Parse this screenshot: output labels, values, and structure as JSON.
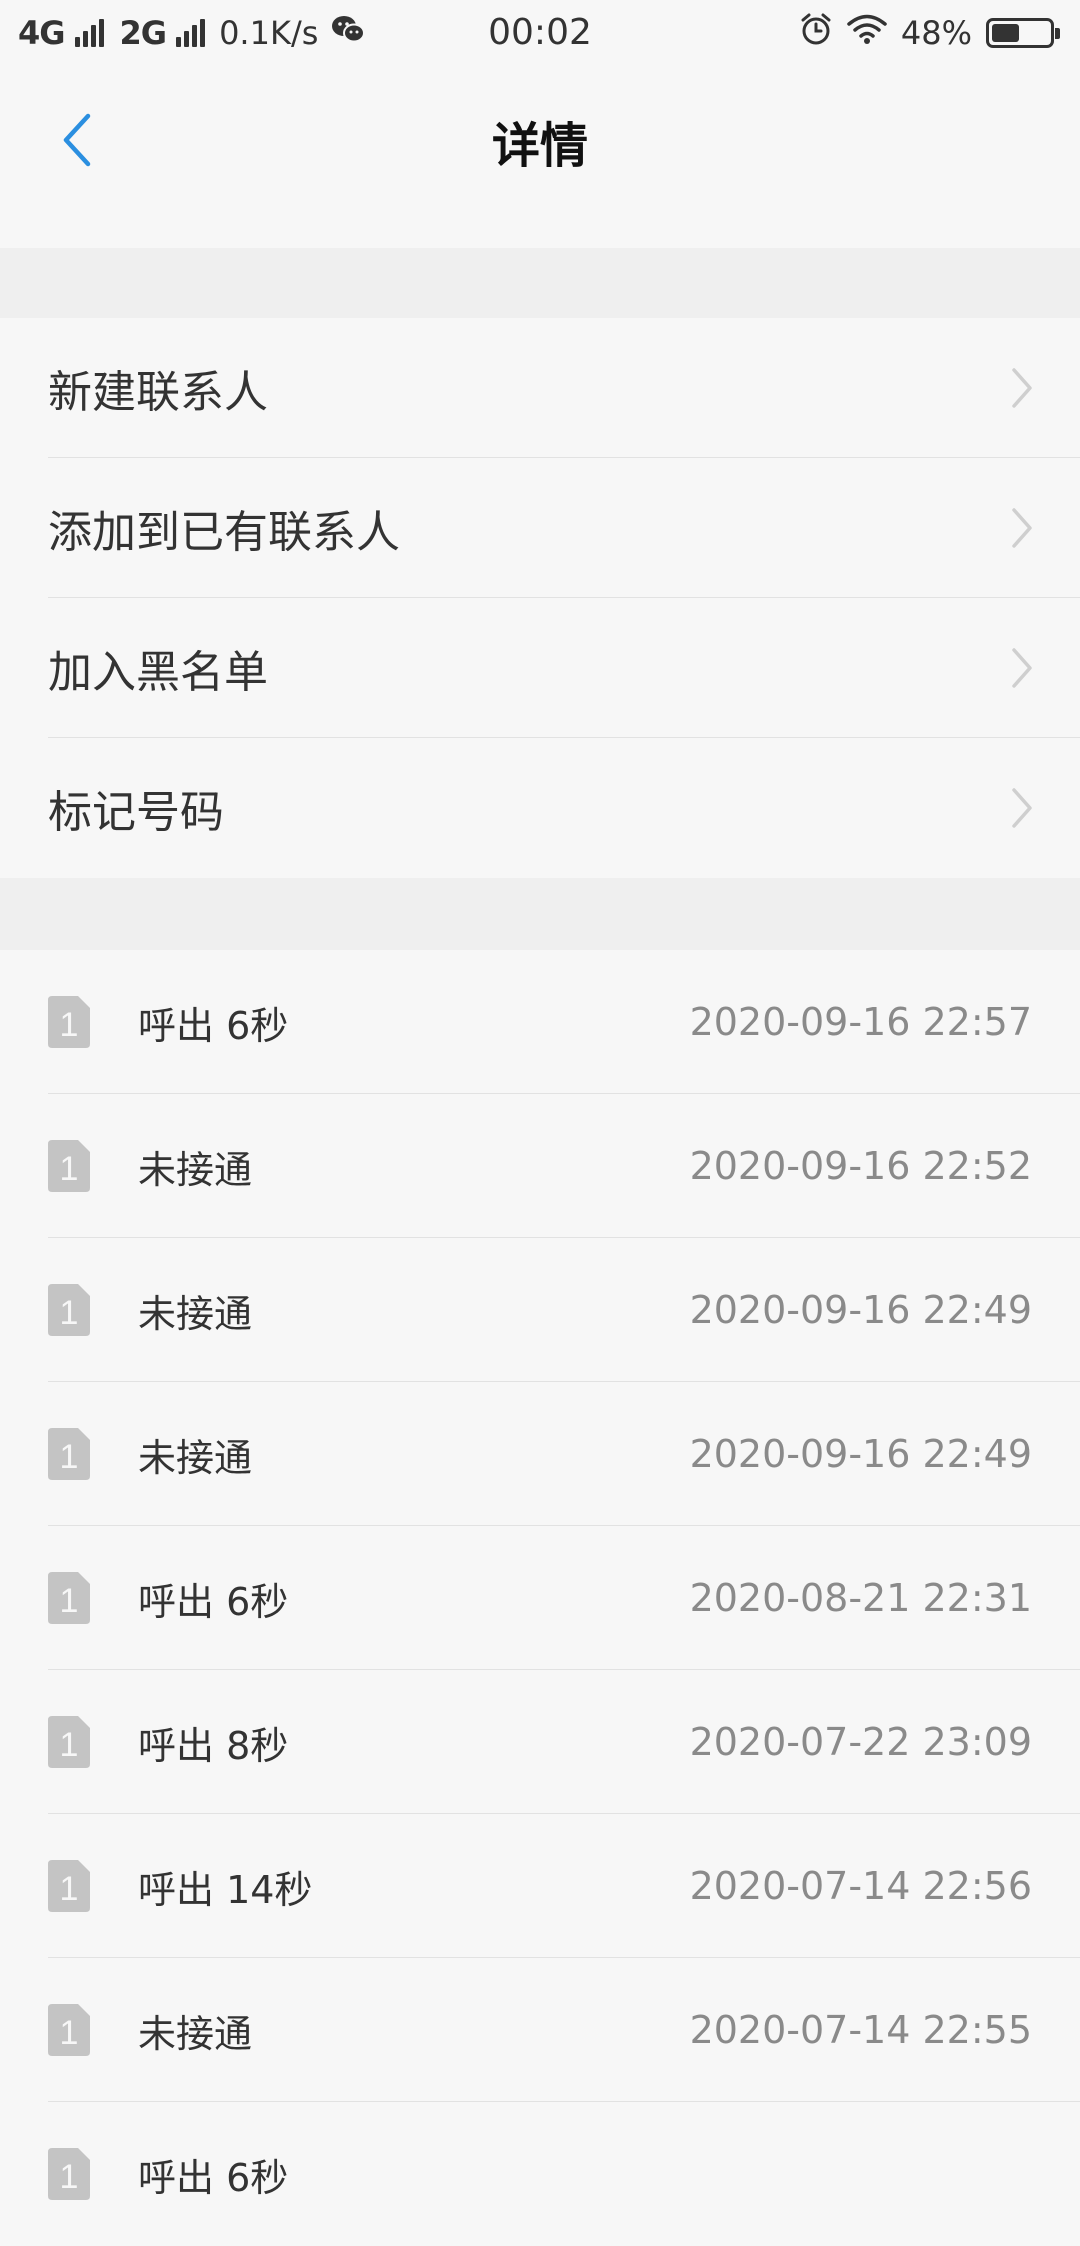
{
  "status_bar": {
    "net1": "4G",
    "net2": "2G",
    "speed": "0.1K/s",
    "time": "00:02",
    "battery_text": "48%",
    "battery_level": 0.48,
    "icons": [
      "signal-icon",
      "wechat-icon",
      "alarm-icon",
      "wifi-icon",
      "battery-icon"
    ]
  },
  "header": {
    "title": "详情",
    "back_icon": "chevron-left-icon",
    "accent_color": "#2b8fe0"
  },
  "actions": [
    {
      "label": "新建联系人"
    },
    {
      "label": "添加到已有联系人"
    },
    {
      "label": "加入黑名单"
    },
    {
      "label": "标记号码"
    }
  ],
  "calls": [
    {
      "sim": "1",
      "type": "呼出 6秒",
      "time": "2020-09-16 22:57"
    },
    {
      "sim": "1",
      "type": "未接通",
      "time": "2020-09-16 22:52"
    },
    {
      "sim": "1",
      "type": "未接通",
      "time": "2020-09-16 22:49"
    },
    {
      "sim": "1",
      "type": "未接通",
      "time": "2020-09-16 22:49"
    },
    {
      "sim": "1",
      "type": "呼出 6秒",
      "time": "2020-08-21 22:31"
    },
    {
      "sim": "1",
      "type": "呼出 8秒",
      "time": "2020-07-22 23:09"
    },
    {
      "sim": "1",
      "type": "呼出 14秒",
      "time": "2020-07-14 22:56"
    },
    {
      "sim": "1",
      "type": "未接通",
      "time": "2020-07-14 22:55"
    },
    {
      "sim": "1",
      "type": "呼出 6秒",
      "time": ""
    }
  ]
}
